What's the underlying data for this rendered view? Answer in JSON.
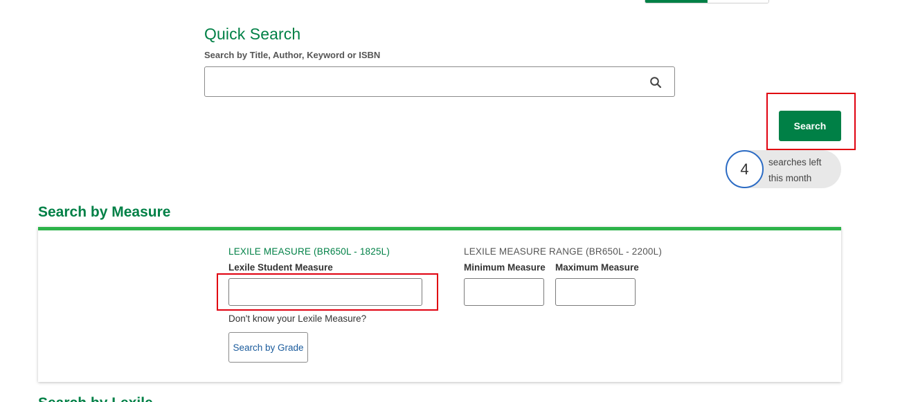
{
  "quick_search": {
    "title": "Quick Search",
    "hint": "Search by Title, Author, Keyword or ISBN",
    "input_value": "",
    "input_placeholder": "",
    "search_icon": "search-icon",
    "search_button_label": "Search"
  },
  "searches_left": {
    "count": "4",
    "label": "searches left this month"
  },
  "search_by_measure": {
    "title": "Search by Measure",
    "lexile_measure_label": "LEXILE MEASURE (BR650L - 1825L)",
    "lexile_student_label": "Lexile Student Measure",
    "lexile_student_value": "",
    "range_label": "LEXILE MEASURE RANGE (BR650L - 2200L)",
    "min_label": "Minimum Measure",
    "min_value": "",
    "max_label": "Maximum Measure",
    "max_value": "",
    "dont_know_text": "Don't know your Lexile Measure?",
    "grade_button_label": "Search by Grade"
  },
  "next_section": {
    "title": "Search by Lexile"
  },
  "colors": {
    "brand_green": "#008046",
    "accent_bar": "#2db34a",
    "highlight_red": "#e0000f",
    "counter_ring": "#2b6bc4",
    "link_blue": "#1a5b9c"
  }
}
